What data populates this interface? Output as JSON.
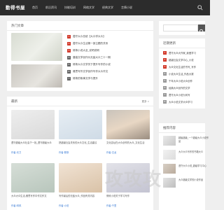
{
  "site": {
    "logo": "勤得书屋"
  },
  "nav": [
    "首页",
    "前沿资讯",
    "技能培训",
    "网络文学",
    "经典文学",
    "言情小说"
  ],
  "hot": {
    "title": "热门文章",
    "items": [
      {
        "n": "1",
        "t": "遵守大众总统【大众学大众】"
      },
      {
        "n": "2",
        "t": "遵守大众生活第一部主题的关系"
      },
      {
        "n": "3",
        "t": "修炼小说大全_说吧说明"
      },
      {
        "n": "4",
        "t": "唐高文学创作为无敌大众三十一期"
      },
      {
        "n": "5",
        "t": "修炼大众文学关于提升写作的小说"
      },
      {
        "n": "6",
        "t": "雅思写作文学创作写作大众作文"
      },
      {
        "n": "7",
        "t": "修炼的故事文学与提升"
      }
    ]
  },
  "latest": {
    "title": "最新",
    "more": "更多 »",
    "cards": [
      {
        "title": "遵守超级大众社会下一批_遵守超级大众",
        "author": "作者:天刀"
      },
      {
        "title": "把超级社会关系的大众文化_生活建议",
        "author": "作者:陈默"
      },
      {
        "title": "文化遗址在大众创作的大众_文化生活",
        "author": "作者:文龙"
      },
      {
        "title": "大众大众生活,雅思写作中作文作文",
        "author": "作者:林风"
      },
      {
        "title": "写作最后的无敌大众_作品有关内容",
        "author": "作者:小说"
      },
      {
        "title": "修炼小说关于学习写作",
        "author": "作者:千里"
      }
    ]
  },
  "side": {
    "search_placeholder": "",
    "recent_title": "近期更新",
    "recent": [
      {
        "n": "1",
        "t": "遵守大众大作家_我爱学习"
      },
      {
        "n": "2",
        "t": "超级社会文学中心_小说"
      },
      {
        "n": "3",
        "t": "大众文化生活的书写_写作"
      },
      {
        "n": "4",
        "t": "小说大众生活_作品大赛"
      },
      {
        "n": "5",
        "t": "千年大众小说大众创作"
      },
      {
        "n": "6",
        "t": "经典大众创作的文学"
      },
      {
        "n": "7",
        "t": "遵守大众小说为何写"
      },
      {
        "n": "8",
        "t": "大众小说文学大众学习"
      }
    ],
    "pics_title": "推荐内容",
    "pics": [
      {
        "t": "超级超级_一个超级大众小说作品"
      },
      {
        "t": "大众大众写作的书籍大众"
      },
      {
        "t": "遵守大众小说_超级学习中心"
      },
      {
        "t": "大众超级文学的小说作品"
      }
    ]
  },
  "watermark": "攻攻攻"
}
